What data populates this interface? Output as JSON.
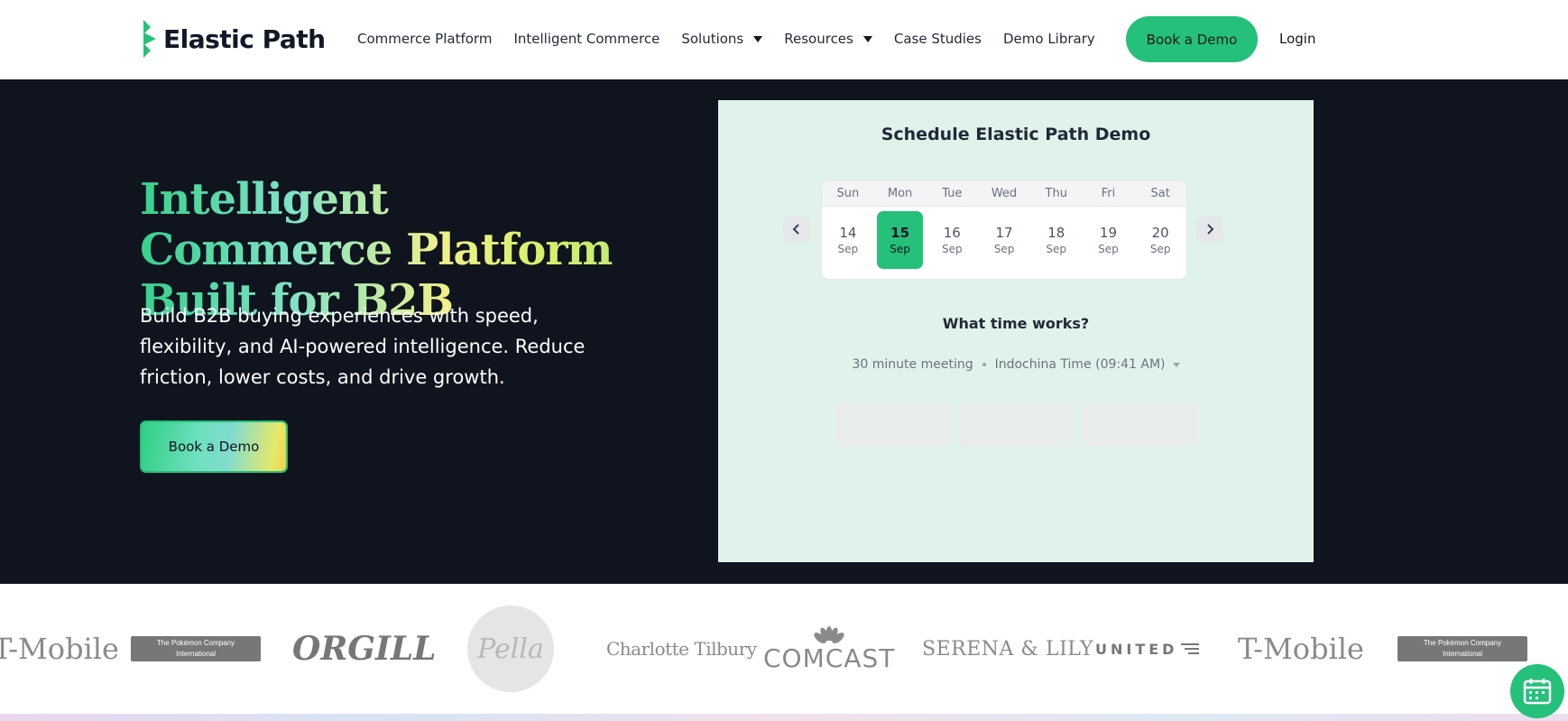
{
  "header": {
    "brand": "Elastic Path",
    "nav": [
      {
        "label": "Commerce Platform",
        "dropdown": false
      },
      {
        "label": "Intelligent Commerce",
        "dropdown": false
      },
      {
        "label": "Solutions",
        "dropdown": true
      },
      {
        "label": "Resources",
        "dropdown": true
      },
      {
        "label": "Case Studies",
        "dropdown": false
      },
      {
        "label": "Demo Library",
        "dropdown": false
      }
    ],
    "cta": "Book a Demo",
    "login": "Login"
  },
  "hero": {
    "title": "Intelligent Commerce Platform Built for B2B",
    "subtitle": "Build B2B buying experiences with speed, flexibility, and AI-powered intelligence. Reduce friction, lower costs, and drive growth.",
    "cta": "Book a Demo"
  },
  "scheduler": {
    "title": "Schedule Elastic Path Demo",
    "weekdays": [
      "Sun",
      "Mon",
      "Tue",
      "Wed",
      "Thu",
      "Fri",
      "Sat"
    ],
    "days": [
      {
        "num": "14",
        "month": "Sep",
        "selected": false
      },
      {
        "num": "15",
        "month": "Sep",
        "selected": true
      },
      {
        "num": "16",
        "month": "Sep",
        "selected": false
      },
      {
        "num": "17",
        "month": "Sep",
        "selected": false
      },
      {
        "num": "18",
        "month": "Sep",
        "selected": false
      },
      {
        "num": "19",
        "month": "Sep",
        "selected": false
      },
      {
        "num": "20",
        "month": "Sep",
        "selected": false
      }
    ],
    "time_question": "What time works?",
    "duration": "30 minute meeting",
    "timezone": "Indochina Time (09:41 AM)",
    "slot_count_visible": 3
  },
  "logos": [
    "T-Mobile",
    "The Pokémon Company International",
    "ORGILL",
    "Pella",
    "Charlotte Tilbury",
    "COMCAST",
    "SERENA & LILY",
    "UNITED",
    "T-Mobile",
    "The Pokémon Company International"
  ],
  "colors": {
    "accent": "#25c07a",
    "hero_bg": "#0f141f",
    "scheduler_bg": "#dff3ea"
  }
}
